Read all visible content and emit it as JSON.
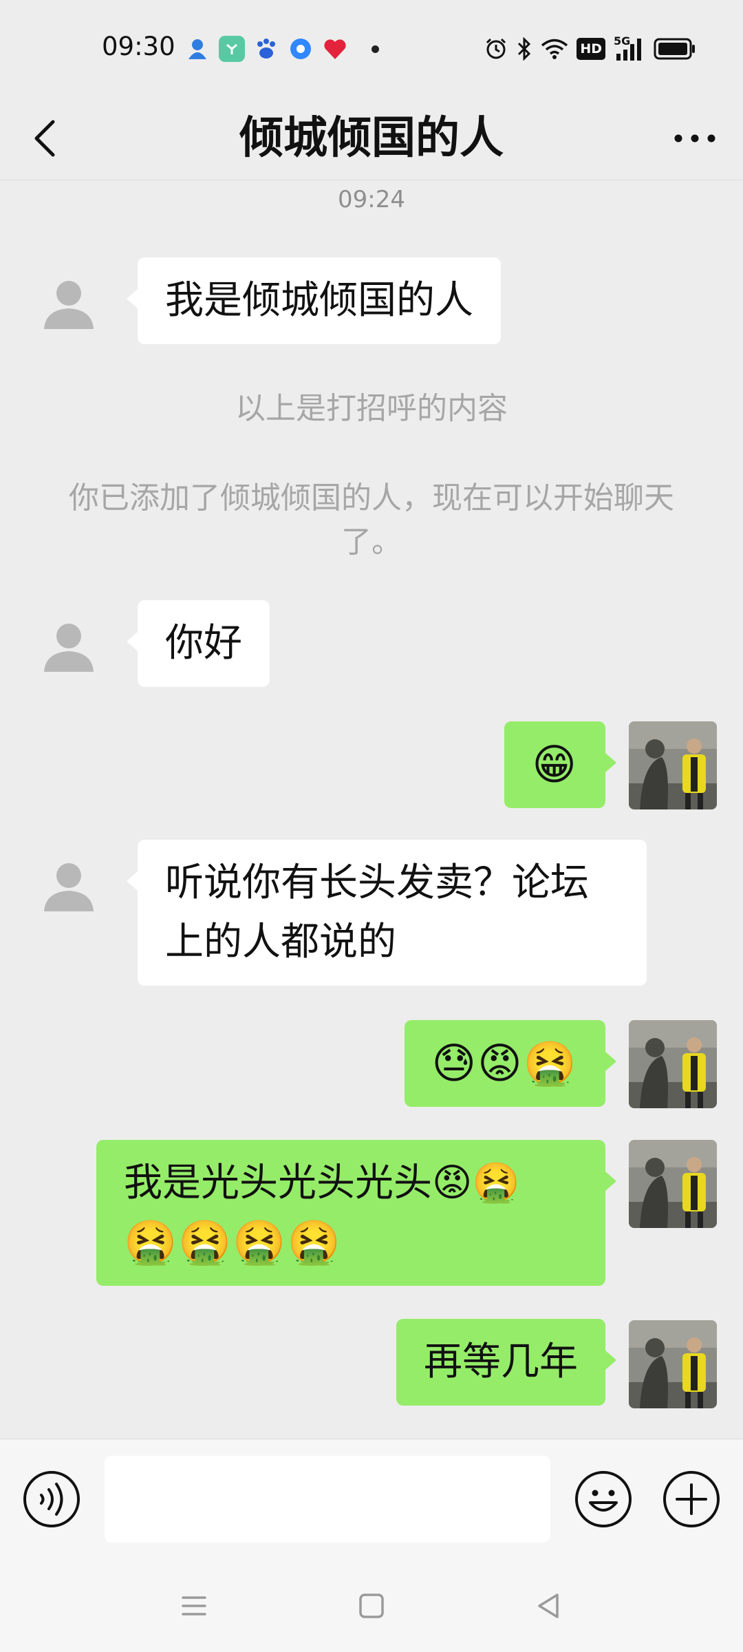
{
  "status_bar": {
    "time": "09:30",
    "notification_icons": [
      {
        "name": "app-notification-icon",
        "color": "#2f7de1"
      },
      {
        "name": "app-notification-icon",
        "color": "#58c9a3"
      },
      {
        "name": "baidu-icon",
        "color": "#2a62d8"
      },
      {
        "name": "app-notification-icon",
        "color": "#2f88ff"
      },
      {
        "name": "app-notification-icon",
        "color": "#e2233b"
      }
    ],
    "system_icons": [
      "alarm-icon",
      "bluetooth-icon",
      "wifi-icon",
      "hd-icon",
      "signal-5g-icon",
      "battery-icon"
    ],
    "hd_label": "HD",
    "network_label": "5G"
  },
  "nav": {
    "title": "倾城倾国的人"
  },
  "chat": {
    "timestamp": "09:24",
    "system_messages": [
      "以上是打招呼的内容",
      "你已添加了倾城倾国的人，现在可以开始聊天了。"
    ],
    "messages": [
      {
        "side": "left",
        "text": "我是倾城倾国的人"
      },
      {
        "side": "left",
        "text": "你好"
      },
      {
        "side": "right",
        "text": "😁"
      },
      {
        "side": "left",
        "text": "听说你有长头发卖？论坛上的人都说的"
      },
      {
        "side": "right",
        "text": "😓😡🤮"
      },
      {
        "side": "right",
        "text": "我是光头光头光头😡🤮",
        "text_line2": "🤮🤮🤮🤮"
      },
      {
        "side": "right",
        "text": "再等几年"
      }
    ]
  },
  "input_bar": {
    "placeholder": "",
    "icons": [
      "voice-icon",
      "emoji-icon",
      "plus-icon"
    ]
  },
  "system_nav": {
    "buttons": [
      "menu-icon",
      "home-icon",
      "back-icon"
    ]
  },
  "colors": {
    "background": "#ededed",
    "bubble_self": "#95ec69",
    "bubble_other": "#ffffff",
    "system_text": "#a6a6a6"
  }
}
